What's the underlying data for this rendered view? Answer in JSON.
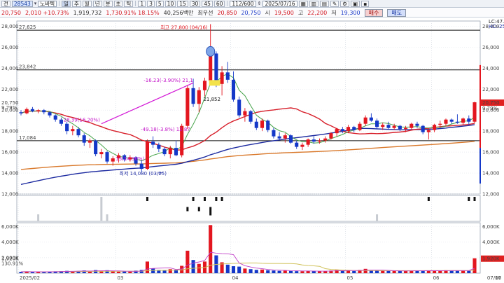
{
  "toolbar": {
    "title_code": "전",
    "stock_code": "28543",
    "period_label": "노바텍",
    "periods": [
      "주",
      "월",
      "년",
      "분",
      "초",
      "틱"
    ],
    "minutes": [
      "1",
      "3",
      "5",
      "10",
      "15",
      "30",
      "45",
      "60"
    ],
    "count": "112/600",
    "date": "2025/07/16"
  },
  "quote": {
    "price": "20,750",
    "change": "2,010 +10.73%",
    "volume": "1,919,732",
    "volume_ratio": "1,730.91% 18.15%",
    "market_cap": "40,256백만",
    "rank_text": "최우선",
    "ask": "20,850",
    "bid": "20,750",
    "open_label": "시",
    "open": "19,500",
    "high_label": "고",
    "high": "22,200",
    "low_label": "저",
    "low": "19,300",
    "buy_label": "매수",
    "sell_label": "매도"
  },
  "colors": {
    "up": "#e3161f",
    "down": "#1438c8",
    "ma5": "#46a34a",
    "ma20": "#d71f2a",
    "ma60": "#1c2aa0",
    "ma120": "#d9782a",
    "volume_ma": "#d0c25a"
  },
  "chart_data": {
    "type": "candlestick",
    "price_axis": {
      "ticks": [
        "28,000",
        "26,000",
        "24,000",
        "22,000",
        "20,000",
        "18,000",
        "16,000",
        "14,000",
        "12,000"
      ],
      "min": 12000,
      "max": 28500
    },
    "volume_axis": {
      "ticks": [
        "6,000K",
        "4,000K",
        "2,000K"
      ],
      "max": 6500
    },
    "x_ticks": [
      "2025/02",
      "03",
      "04",
      "05",
      "06",
      "07",
      "07/16"
    ],
    "levels": [
      {
        "value": 27625,
        "label": "27,625"
      },
      {
        "value": 23842,
        "label": "23,842"
      },
      {
        "value": 17084,
        "label": "17,084"
      }
    ],
    "annotations": {
      "high": "최고 27,800 (04/16)",
      "low": "최저 14,080 (03/25)",
      "pct1": "28.39(16.20%)",
      "pct2": "-16.23(-3.90%) 21,1",
      "pct3": "-49.18(-3.8%) 12,87",
      "pct4": "15(14.96%)",
      "ma_tag": "21,852",
      "right_val": "20,750",
      "right_pct": "9.79%",
      "right_vol": "1,920K",
      "right_vol_pct": "130.91%",
      "right_top1": "LC:47.37",
      "right_top2": "HC:-25.36"
    },
    "candles": [
      [
        19800,
        20000,
        19500,
        19700
      ],
      [
        19700,
        20250,
        19600,
        20100
      ],
      [
        20100,
        20300,
        19800,
        19900
      ],
      [
        19900,
        20100,
        19700,
        20000
      ],
      [
        20000,
        20100,
        19600,
        19800
      ],
      [
        19800,
        19900,
        19300,
        19500
      ],
      [
        19500,
        19600,
        18900,
        19100
      ],
      [
        19100,
        19300,
        18500,
        18700
      ],
      [
        18700,
        18900,
        17700,
        18000
      ],
      [
        18000,
        18500,
        17600,
        18200
      ],
      [
        18200,
        18400,
        17400,
        17600
      ],
      [
        17600,
        17800,
        16600,
        16900
      ],
      [
        16900,
        17300,
        16400,
        17100
      ],
      [
        17100,
        17200,
        15600,
        15800
      ],
      [
        15800,
        16300,
        15400,
        16000
      ],
      [
        16000,
        16100,
        14900,
        15100
      ],
      [
        15100,
        15600,
        14700,
        15400
      ],
      [
        15400,
        15900,
        15000,
        15700
      ],
      [
        15700,
        15800,
        15100,
        15300
      ],
      [
        15300,
        15700,
        15100,
        15500
      ],
      [
        15500,
        15600,
        14700,
        14900
      ],
      [
        14900,
        15200,
        14080,
        14400
      ],
      [
        14400,
        17200,
        14300,
        17000
      ],
      [
        17000,
        17500,
        16400,
        16700
      ],
      [
        16700,
        16900,
        16000,
        16300
      ],
      [
        16300,
        16500,
        15600,
        15800
      ],
      [
        15800,
        16600,
        15400,
        16400
      ],
      [
        16400,
        17100,
        15600,
        15700
      ],
      [
        15700,
        18700,
        15500,
        18500
      ],
      [
        18500,
        22400,
        18200,
        22100
      ],
      [
        22100,
        23000,
        20300,
        20600
      ],
      [
        20600,
        22200,
        19800,
        21900
      ],
      [
        21900,
        23100,
        21300,
        22800
      ],
      [
        22800,
        27800,
        22400,
        25400
      ],
      [
        25400,
        25600,
        22200,
        22500
      ],
      [
        22500,
        24200,
        21400,
        23600
      ],
      [
        23600,
        24600,
        22600,
        22900
      ],
      [
        22900,
        23700,
        20800,
        21000
      ],
      [
        21000,
        21300,
        19300,
        19500
      ],
      [
        19500,
        20200,
        18900,
        19900
      ],
      [
        19900,
        20000,
        18700,
        18900
      ],
      [
        18900,
        19200,
        18100,
        18300
      ],
      [
        18300,
        19200,
        18000,
        19000
      ],
      [
        19000,
        19100,
        17900,
        18100
      ],
      [
        18100,
        18300,
        17300,
        17500
      ],
      [
        17500,
        17900,
        17100,
        17300
      ],
      [
        17300,
        17800,
        16900,
        17600
      ],
      [
        17600,
        17700,
        16800,
        16900
      ],
      [
        16900,
        17100,
        16300,
        16500
      ],
      [
        16500,
        16900,
        16200,
        16700
      ],
      [
        16700,
        17300,
        16500,
        17200
      ],
      [
        17200,
        17500,
        16800,
        17000
      ],
      [
        17000,
        17300,
        16800,
        17100
      ],
      [
        17100,
        17500,
        16900,
        17300
      ],
      [
        17300,
        17900,
        17200,
        17800
      ],
      [
        17800,
        18300,
        17500,
        18200
      ],
      [
        18200,
        18400,
        17800,
        18000
      ],
      [
        18000,
        18600,
        17800,
        18400
      ],
      [
        18400,
        18500,
        17900,
        18100
      ],
      [
        18100,
        18900,
        18000,
        18700
      ],
      [
        18700,
        19500,
        18500,
        19300
      ],
      [
        19300,
        19700,
        18900,
        19000
      ],
      [
        19000,
        19200,
        18200,
        18400
      ],
      [
        18400,
        18800,
        18100,
        18600
      ],
      [
        18600,
        18900,
        18200,
        18300
      ],
      [
        18300,
        18700,
        18100,
        18500
      ],
      [
        18500,
        18600,
        18000,
        18200
      ],
      [
        18200,
        18500,
        17900,
        18300
      ],
      [
        18300,
        18800,
        18100,
        18700
      ],
      [
        18700,
        18900,
        18300,
        18500
      ],
      [
        18500,
        18600,
        17700,
        17900
      ],
      [
        17900,
        18300,
        17200,
        18100
      ],
      [
        18100,
        18700,
        17900,
        18600
      ],
      [
        18600,
        19000,
        18300,
        18700
      ],
      [
        18700,
        19200,
        18500,
        19100
      ],
      [
        19100,
        19200,
        18700,
        18900
      ],
      [
        18900,
        19600,
        18700,
        18800
      ],
      [
        18800,
        19300,
        18600,
        19200
      ],
      [
        19200,
        19500,
        18600,
        18900
      ],
      [
        18900,
        20800,
        18740,
        20750
      ]
    ],
    "volume": [
      180,
      220,
      150,
      170,
      160,
      190,
      240,
      260,
      300,
      250,
      280,
      350,
      230,
      400,
      260,
      380,
      240,
      200,
      220,
      210,
      330,
      420,
      1500,
      600,
      420,
      380,
      520,
      450,
      950,
      2900,
      1700,
      1200,
      1500,
      6200,
      2300,
      1400,
      1100,
      900,
      850,
      600,
      520,
      430,
      470,
      380,
      340,
      300,
      330,
      290,
      260,
      250,
      310,
      270,
      240,
      260,
      340,
      420,
      300,
      360,
      280,
      420,
      560,
      380,
      330,
      300,
      290,
      280,
      270,
      300,
      350,
      320,
      290,
      330,
      340,
      300,
      380,
      330,
      310,
      360,
      300,
      1920
    ],
    "indicator": [
      0,
      0,
      0,
      0,
      0,
      0,
      0,
      0,
      0,
      0,
      0,
      0,
      0,
      0,
      0,
      0,
      0,
      0,
      0,
      0,
      0,
      0,
      1,
      0,
      0,
      0,
      0,
      0,
      0,
      -1,
      1,
      -1,
      1,
      -2,
      1,
      1,
      0,
      0,
      0,
      0,
      0,
      0,
      0,
      0,
      0,
      0,
      0,
      0,
      0,
      0,
      0,
      0,
      0,
      0,
      0,
      0,
      0,
      0,
      0,
      0,
      0,
      0,
      0,
      0,
      0,
      0,
      0,
      0,
      0,
      0,
      0,
      1,
      0,
      0,
      0,
      0,
      0,
      0,
      1,
      1
    ]
  }
}
